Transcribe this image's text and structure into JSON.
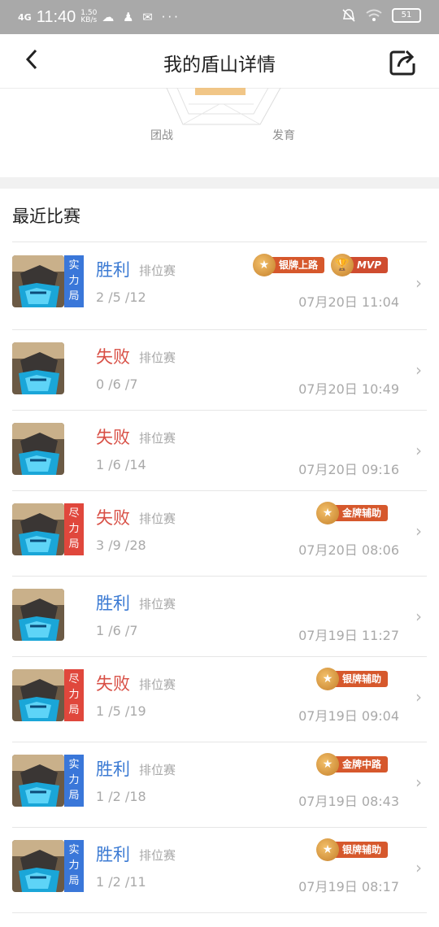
{
  "status": {
    "network": "4G",
    "time": "11:40",
    "speed": "1.50",
    "speed_unit": "KB/s",
    "icons": "☁ ♟ ✉ ···",
    "battery": "51"
  },
  "header": {
    "title": "我的盾山详情"
  },
  "radar": {
    "label_left": "团战",
    "label_right": "发育"
  },
  "section": {
    "title": "最近比赛"
  },
  "matches": [
    {
      "tag": "实力局",
      "result": "胜利",
      "mode": "排位赛",
      "kda": "2 /5 /12",
      "date": "07月20日 11:04",
      "badges": [
        "银牌上路",
        "MVP"
      ]
    },
    {
      "tag": "",
      "result": "失败",
      "mode": "排位赛",
      "kda": "0 /6 /7",
      "date": "07月20日 10:49",
      "badges": []
    },
    {
      "tag": "",
      "result": "失败",
      "mode": "排位赛",
      "kda": "1 /6 /14",
      "date": "07月20日 09:16",
      "badges": []
    },
    {
      "tag": "尽力局",
      "result": "失败",
      "mode": "排位赛",
      "kda": "3 /9 /28",
      "date": "07月20日 08:06",
      "badges": [
        "金牌辅助"
      ]
    },
    {
      "tag": "",
      "result": "胜利",
      "mode": "排位赛",
      "kda": "1 /6 /7",
      "date": "07月19日 11:27",
      "badges": []
    },
    {
      "tag": "尽力局",
      "result": "失败",
      "mode": "排位赛",
      "kda": "1 /5 /19",
      "date": "07月19日 09:04",
      "badges": [
        "银牌辅助"
      ]
    },
    {
      "tag": "实力局",
      "result": "胜利",
      "mode": "排位赛",
      "kda": "1 /2 /18",
      "date": "07月19日 08:43",
      "badges": [
        "金牌中路"
      ]
    },
    {
      "tag": "实力局",
      "result": "胜利",
      "mode": "排位赛",
      "kda": "1 /2 /11",
      "date": "07月19日 08:17",
      "badges": [
        "银牌辅助"
      ]
    }
  ]
}
